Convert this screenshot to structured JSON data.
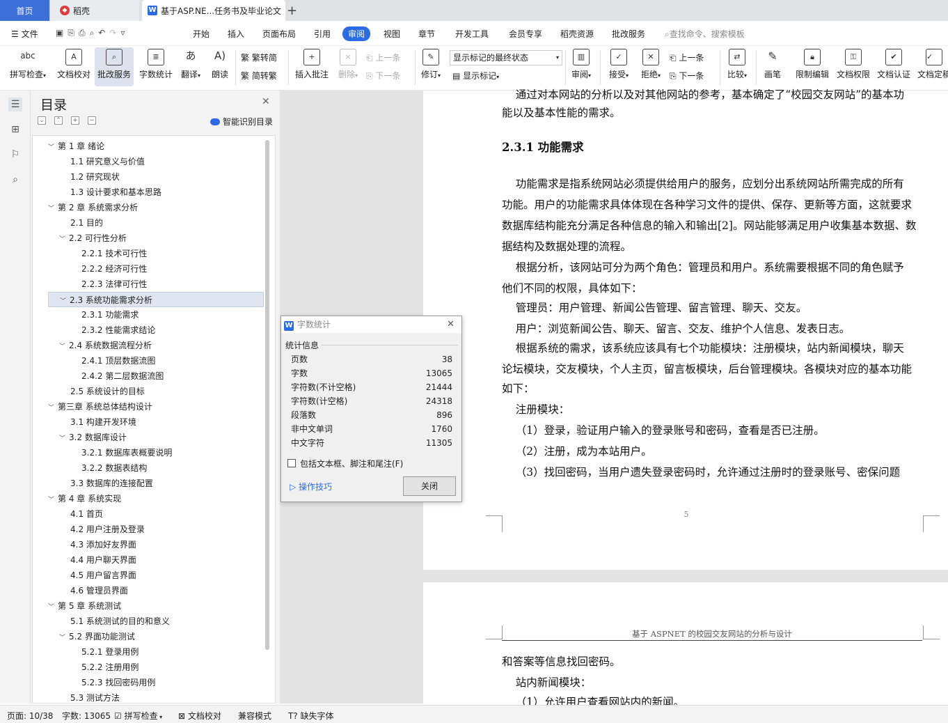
{
  "tabs": {
    "home": "首页",
    "daoke": "稻壳",
    "doc": "基于ASP.NE...任务书及毕业论文",
    "add": "+"
  },
  "menu": {
    "file": "文件",
    "items": [
      "开始",
      "插入",
      "页面布局",
      "引用",
      "审阅",
      "视图",
      "章节",
      "开发工具",
      "会员专享",
      "稻壳资源",
      "批改服务"
    ],
    "search": "查找命令、搜索模板"
  },
  "ribbon": {
    "spell": "拼写检查",
    "proof": "文档校对",
    "review_service": "批改服务",
    "wordcount": "字数统计",
    "translate": "翻译",
    "read": "朗读",
    "trad_simp": "繁转简",
    "simp_trad": "简转繁",
    "insert_comment": "插入批注",
    "delete": "删除",
    "prev": "上一条",
    "next": "下一条",
    "revise": "修订",
    "markup_state": "显示标记的最终状态",
    "show_markup": "显示标记",
    "review": "审阅",
    "accept": "接受",
    "reject": "拒绝",
    "prev2": "上一条",
    "next2": "下一条",
    "compare": "比较",
    "pen": "画笔",
    "restrict": "限制编辑",
    "permission": "文档权限",
    "certify": "文档认证",
    "finalize": "文档定稿"
  },
  "toc": {
    "title": "目录",
    "smart": "智能识别目录",
    "items": [
      {
        "text": "第 1 章  绪论",
        "level": 1,
        "chev": "v"
      },
      {
        "text": "1.1 研究意义与价值",
        "level": 2,
        "chev": ""
      },
      {
        "text": "1.2 研究现状",
        "level": 2,
        "chev": ""
      },
      {
        "text": "1.3 设计要求和基本思路",
        "level": 2,
        "chev": ""
      },
      {
        "text": "第 2 章  系统需求分析",
        "level": 1,
        "chev": "v"
      },
      {
        "text": "2.1 目的",
        "level": 2,
        "chev": ""
      },
      {
        "text": "2.2 可行性分析",
        "level": 2,
        "chev": "v"
      },
      {
        "text": "2.2.1 技术可行性",
        "level": 3,
        "chev": ""
      },
      {
        "text": "2.2.2 经济可行性",
        "level": 3,
        "chev": ""
      },
      {
        "text": "2.2.3 法律可行性",
        "level": 3,
        "chev": ""
      },
      {
        "text": "2.3 系统功能需求分析",
        "level": 2,
        "chev": "v",
        "selected": true
      },
      {
        "text": "2.3.1 功能需求",
        "level": 3,
        "chev": ""
      },
      {
        "text": "2.3.2 性能需求结论",
        "level": 3,
        "chev": ""
      },
      {
        "text": "2.4 系统数据流程分析",
        "level": 2,
        "chev": "v"
      },
      {
        "text": "2.4.1 顶层数据流图",
        "level": 3,
        "chev": ""
      },
      {
        "text": "2.4.2 第二层数据流图",
        "level": 3,
        "chev": ""
      },
      {
        "text": "2.5 系统设计的目标",
        "level": 2,
        "chev": ""
      },
      {
        "text": "第三章  系统总体结构设计",
        "level": 1,
        "chev": "v"
      },
      {
        "text": "3.1 构建开发环境",
        "level": 2,
        "chev": ""
      },
      {
        "text": "3.2 数据库设计",
        "level": 2,
        "chev": "v"
      },
      {
        "text": "3.2.1 数据库表概要说明",
        "level": 3,
        "chev": ""
      },
      {
        "text": "3.2.2 数据表结构",
        "level": 3,
        "chev": ""
      },
      {
        "text": "3.3 数据库的连接配置",
        "level": 2,
        "chev": ""
      },
      {
        "text": "第 4 章  系统实现",
        "level": 1,
        "chev": "v"
      },
      {
        "text": "4.1 首页",
        "level": 2,
        "chev": ""
      },
      {
        "text": "4.2 用户注册及登录",
        "level": 2,
        "chev": ""
      },
      {
        "text": "4.3 添加好友界面",
        "level": 2,
        "chev": ""
      },
      {
        "text": "4.4 用户聊天界面",
        "level": 2,
        "chev": ""
      },
      {
        "text": "4.5 用户留言界面",
        "level": 2,
        "chev": ""
      },
      {
        "text": "4.6 管理员界面",
        "level": 2,
        "chev": ""
      },
      {
        "text": "第 5 章  系统测试",
        "level": 1,
        "chev": "v"
      },
      {
        "text": "5.1 系统测试的目的和意义",
        "level": 2,
        "chev": ""
      },
      {
        "text": "5.2 界面功能测试",
        "level": 2,
        "chev": "v"
      },
      {
        "text": "5.2.1 登录用例",
        "level": 3,
        "chev": ""
      },
      {
        "text": "5.2.2 注册用例",
        "level": 3,
        "chev": ""
      },
      {
        "text": "5.2.3 找回密码用例",
        "level": 3,
        "chev": ""
      },
      {
        "text": "5.3 测试方法",
        "level": 2,
        "chev": ""
      }
    ]
  },
  "document": {
    "page1": [
      "    通过对本网站的分析以及对其他网站的参考，基本确定了“校园交友网站”的基本功",
      "能以及基本性能的需求。",
      "2.3.1 功能需求",
      "    功能需求是指系统网站必须提供给用户的服务，应划分出系统网站所需完成的所有",
      "功能。用户的功能需求具体体现在各种学习文件的提供、保存、更新等方面，这就要求",
      "数据库结构能充分满足各种信息的输入和输出[2]。网站能够满足用户收集基本数据、数",
      "据结构及数据处理的流程。",
      "    根据分析，该网站可分为两个角色：管理员和用户。系统需要根据不同的角色赋予",
      "他们不同的权限，具体如下：",
      "    管理员：用户管理、新闻公告管理、留言管理、聊天、交友。",
      "    用户：浏览新闻公告、聊天、留言、交友、维护个人信息、发表日志。",
      "    根据系统的需求，该系统应该具有七个功能模块：注册模块，站内新闻模块，聊天",
      "论坛模块，交友模块，个人主页，留言板模块，后台管理模块。各模块对应的基本功能",
      "如下：",
      "    注册模块：",
      "    （1）登录，验证用户输入的登录账号和密码，查看是否已注册。",
      "    （2）注册，成为本站用户。",
      "    （3）找回密码，当用户遗失登录密码时，允许通过注册时的登录账号、密保问题"
    ],
    "page_number": "5",
    "header2": "基于 ASPNET 的校园交友网站的分析与设计",
    "page2": [
      "和答案等信息找回密码。",
      "    站内新闻模块：",
      "    （1）允许用户查看网站内的新闻。"
    ]
  },
  "dialog": {
    "title": "字数统计",
    "section": "统计信息",
    "rows": [
      {
        "label": "页数",
        "value": "38"
      },
      {
        "label": "字数",
        "value": "13065"
      },
      {
        "label": "字符数(不计空格)",
        "value": "21444"
      },
      {
        "label": "字符数(计空格)",
        "value": "24318"
      },
      {
        "label": "段落数",
        "value": "896"
      },
      {
        "label": "非中文单词",
        "value": "1760"
      },
      {
        "label": "中文字符",
        "value": "11305"
      }
    ],
    "checkbox": "包括文本框、脚注和尾注(F)",
    "tip": "操作技巧",
    "close": "关闭"
  },
  "status": {
    "page": "页面: 10/38",
    "words": "字数: 13065",
    "spell": "拼写检查",
    "proof": "文档校对",
    "compat": "兼容模式",
    "missing_font": "缺失字体"
  }
}
